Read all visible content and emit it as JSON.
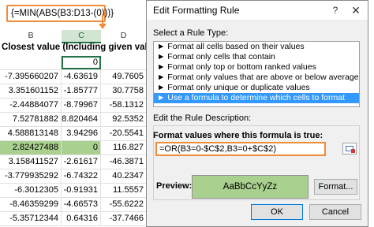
{
  "formula_bar": {
    "text": "{=MIN(ABS(B3:D13-(0)))}"
  },
  "sheet": {
    "columns": [
      "B",
      "C",
      "D"
    ],
    "header_text": "Closest value (Including given value)",
    "rows": [
      [
        "",
        "0",
        ""
      ],
      [
        "-7.395660207",
        "-4.63619",
        "49.7605"
      ],
      [
        "3.351601152",
        "-1.85777",
        "30.7758"
      ],
      [
        "-2.44884077",
        "-8.79967",
        "-58.1312"
      ],
      [
        "7.52781882",
        "8.820464",
        "92.5352"
      ],
      [
        "4.588813148",
        "3.94296",
        "-20.5541"
      ],
      [
        "2.82427488",
        "0",
        "116.827"
      ],
      [
        "3.158411527",
        "-2.61617",
        "-46.3871"
      ],
      [
        "-3.779935292",
        "-6.74322",
        "40.2347"
      ],
      [
        "-6.3012305",
        "-0.91931",
        "11.5557"
      ],
      [
        "-8.46359299",
        "-4.66573",
        "-55.6222"
      ],
      [
        "-5.35712344",
        "0.64316",
        "-37.7466"
      ]
    ]
  },
  "dialog": {
    "title": "Edit Formatting Rule",
    "help": "?",
    "close": "✕",
    "select_rule_label": "Select a Rule Type:",
    "rule_types": [
      "► Format all cells based on their values",
      "► Format only cells that contain",
      "► Format only top or bottom ranked values",
      "► Format only values that are above or below average",
      "► Format only unique or duplicate values",
      "► Use a formula to determine which cells to format"
    ],
    "edit_desc_label": "Edit the Rule Description:",
    "format_values_label": "Format values where this formula is true:",
    "formula": "=OR(B3=0-$C$2,B3=0+$C$2)",
    "preview_label": "Preview:",
    "preview_text": "AaBbCcYyZz",
    "format_button": "Format...",
    "ok_button": "OK",
    "cancel_button": "Cancel"
  },
  "colors": {
    "highlight": "#a9d08e",
    "accent_orange": "#f08c3c",
    "selection_blue": "#3399ff"
  }
}
